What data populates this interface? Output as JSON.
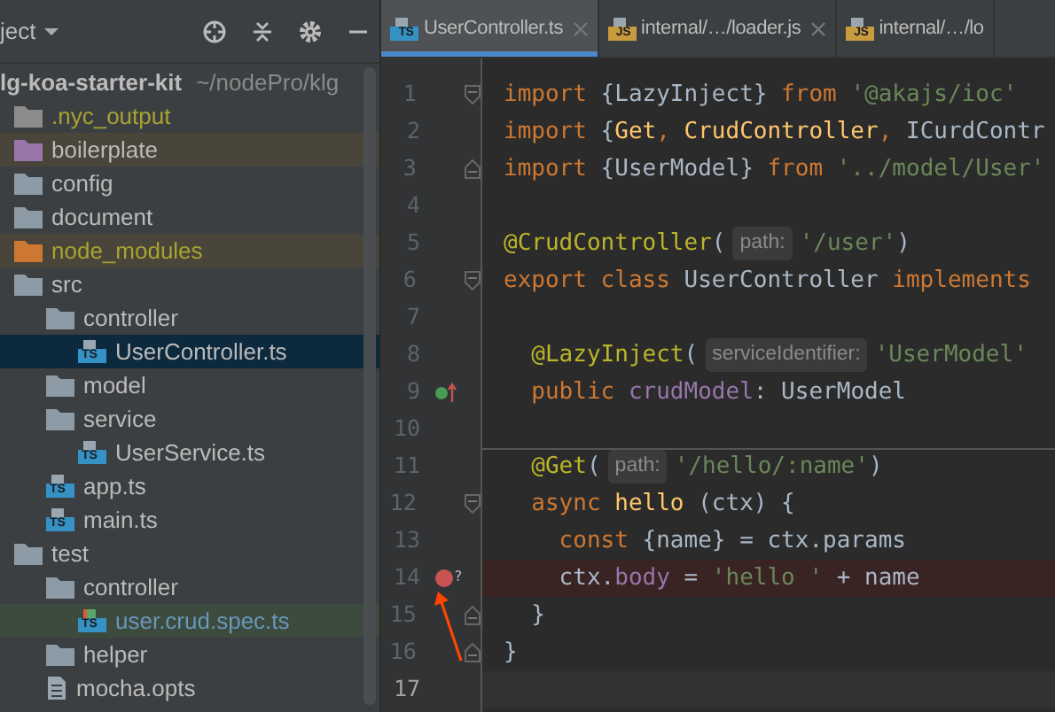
{
  "project_panel": {
    "title": "ject",
    "root": {
      "name": "lg-koa-starter-kit",
      "path": "~/nodePro/klg"
    },
    "tree": [
      {
        "name": ".nyc_output",
        "kind": "folder",
        "color": "#8c8c8c",
        "excluded": true,
        "highlighted": false,
        "selected": false,
        "focused": false,
        "modified": false
      },
      {
        "name": "boilerplate",
        "kind": "folder",
        "color": "#9876aa",
        "excluded": false,
        "highlighted": true,
        "selected": false,
        "focused": false,
        "modified": false
      },
      {
        "name": "config",
        "kind": "folder",
        "color": "#8c9ba5",
        "excluded": false,
        "highlighted": false,
        "selected": false,
        "focused": false,
        "modified": false
      },
      {
        "name": "document",
        "kind": "folder",
        "color": "#8c9ba5",
        "excluded": false,
        "highlighted": false,
        "selected": false,
        "focused": false,
        "modified": false
      },
      {
        "name": "node_modules",
        "kind": "folder",
        "color": "#cc7832",
        "excluded": true,
        "highlighted": true,
        "selected": false,
        "focused": false,
        "modified": false
      },
      {
        "name": "src",
        "kind": "folder",
        "color": "#8c9ba5",
        "excluded": false,
        "highlighted": false,
        "selected": false,
        "focused": false,
        "modified": false,
        "children": [
          {
            "name": "controller",
            "kind": "folder",
            "color": "#8c9ba5",
            "excluded": false,
            "highlighted": false,
            "selected": false,
            "focused": false,
            "modified": false,
            "children": [
              {
                "name": "UserController.ts",
                "kind": "ts",
                "icon_label": "TS",
                "excluded": false,
                "highlighted": false,
                "selected": true,
                "focused": false,
                "modified": false
              }
            ]
          },
          {
            "name": "model",
            "kind": "folder",
            "color": "#8c9ba5",
            "excluded": false,
            "highlighted": false,
            "selected": false,
            "focused": false,
            "modified": false
          },
          {
            "name": "service",
            "kind": "folder",
            "color": "#8c9ba5",
            "excluded": false,
            "highlighted": false,
            "selected": false,
            "focused": false,
            "modified": false,
            "children": [
              {
                "name": "UserService.ts",
                "kind": "ts",
                "icon_label": "TS",
                "excluded": false,
                "highlighted": false,
                "selected": false,
                "focused": false,
                "modified": false
              }
            ]
          },
          {
            "name": "app.ts",
            "kind": "ts",
            "icon_label": "TS",
            "excluded": false,
            "highlighted": false,
            "selected": false,
            "focused": false,
            "modified": false
          },
          {
            "name": "main.ts",
            "kind": "ts",
            "icon_label": "TS",
            "excluded": false,
            "highlighted": false,
            "selected": false,
            "focused": false,
            "modified": false
          }
        ]
      },
      {
        "name": "test",
        "kind": "folder",
        "color": "#8c9ba5",
        "excluded": false,
        "highlighted": false,
        "selected": false,
        "focused": false,
        "modified": false,
        "children": [
          {
            "name": "controller",
            "kind": "folder",
            "color": "#8c9ba5",
            "excluded": false,
            "highlighted": false,
            "selected": false,
            "focused": false,
            "modified": false,
            "children": [
              {
                "name": "user.crud.spec.ts",
                "kind": "test",
                "icon_label": "TS",
                "excluded": false,
                "highlighted": false,
                "selected": false,
                "focused": true,
                "modified": true
              }
            ]
          },
          {
            "name": "helper",
            "kind": "folder",
            "color": "#8c9ba5",
            "excluded": false,
            "highlighted": false,
            "selected": false,
            "focused": false,
            "modified": false
          },
          {
            "name": "mocha.opts",
            "kind": "file",
            "excluded": false,
            "highlighted": false,
            "selected": false,
            "focused": false,
            "modified": false
          }
        ]
      }
    ]
  },
  "tabs": [
    {
      "label": "UserController.ts",
      "kind": "ts",
      "icon_label": "TS",
      "selected": true,
      "closable": true
    },
    {
      "label": "internal/…/loader.js",
      "kind": "js",
      "icon_label": "JS",
      "selected": false,
      "closable": true
    },
    {
      "label": "internal/…/lo",
      "kind": "js",
      "icon_label": "JS",
      "selected": false,
      "closable": false
    }
  ],
  "editor": {
    "lines": [
      {
        "number": "1",
        "fold_start": true,
        "fold_end": false,
        "implemented": false,
        "breakpoint": false,
        "current": false,
        "method_separator": false,
        "tokens": [
          {
            "kind": "kw",
            "text": "import "
          },
          {
            "kind": "plain",
            "text": "{LazyInject} "
          },
          {
            "kind": "kw",
            "text": "from "
          },
          {
            "kind": "str",
            "text": "'@akajs/ioc'"
          }
        ]
      },
      {
        "number": "2",
        "fold_start": false,
        "fold_end": false,
        "implemented": false,
        "breakpoint": false,
        "current": false,
        "method_separator": false,
        "tokens": [
          {
            "kind": "kw",
            "text": "import "
          },
          {
            "kind": "plain",
            "text": "{"
          },
          {
            "kind": "fn",
            "text": "Get"
          },
          {
            "kind": "kw",
            "text": ", "
          },
          {
            "kind": "fn",
            "text": "CrudController"
          },
          {
            "kind": "kw",
            "text": ", "
          },
          {
            "kind": "plain",
            "text": "ICurdContr"
          }
        ]
      },
      {
        "number": "3",
        "fold_start": false,
        "fold_end": true,
        "implemented": false,
        "breakpoint": false,
        "current": false,
        "method_separator": false,
        "tokens": [
          {
            "kind": "kw",
            "text": "import "
          },
          {
            "kind": "plain",
            "text": "{UserModel} "
          },
          {
            "kind": "kw",
            "text": "from "
          },
          {
            "kind": "str",
            "text": "'../model/User'"
          }
        ]
      },
      {
        "number": "4",
        "fold_start": false,
        "fold_end": false,
        "implemented": false,
        "breakpoint": false,
        "current": false,
        "method_separator": false
      },
      {
        "number": "5",
        "fold_start": false,
        "fold_end": false,
        "implemented": false,
        "breakpoint": false,
        "current": false,
        "method_separator": false,
        "tokens": [
          {
            "kind": "ann",
            "text": "@CrudController"
          },
          {
            "kind": "plain",
            "text": "("
          },
          {
            "kind": "hint",
            "text": "path:"
          },
          {
            "kind": "str",
            "text": "'/user'"
          },
          {
            "kind": "plain",
            "text": ")"
          }
        ]
      },
      {
        "number": "6",
        "fold_start": true,
        "fold_end": false,
        "implemented": false,
        "breakpoint": false,
        "current": false,
        "method_separator": false,
        "tokens": [
          {
            "kind": "kw",
            "text": "export class "
          },
          {
            "kind": "plain",
            "text": "UserController "
          },
          {
            "kind": "kw",
            "text": "implements"
          }
        ]
      },
      {
        "number": "7",
        "fold_start": false,
        "fold_end": false,
        "implemented": false,
        "breakpoint": false,
        "current": false,
        "method_separator": false
      },
      {
        "number": "8",
        "fold_start": false,
        "fold_end": false,
        "implemented": false,
        "breakpoint": false,
        "current": false,
        "method_separator": false,
        "tokens": [
          {
            "kind": "ann",
            "text": "  @LazyInject"
          },
          {
            "kind": "plain",
            "text": "("
          },
          {
            "kind": "hint",
            "text": "serviceIdentifier:"
          },
          {
            "kind": "str",
            "text": "'UserModel'"
          }
        ]
      },
      {
        "number": "9",
        "fold_start": false,
        "fold_end": false,
        "implemented": true,
        "breakpoint": false,
        "current": false,
        "method_separator": false,
        "tokens": [
          {
            "kind": "kw",
            "text": "  public "
          },
          {
            "kind": "prop",
            "text": "crudModel"
          },
          {
            "kind": "plain",
            "text": ": UserModel"
          }
        ]
      },
      {
        "number": "10",
        "fold_start": false,
        "fold_end": false,
        "implemented": false,
        "breakpoint": false,
        "current": false,
        "method_separator": false
      },
      {
        "number": "11",
        "fold_start": false,
        "fold_end": false,
        "implemented": false,
        "breakpoint": false,
        "current": false,
        "method_separator": true,
        "tokens": [
          {
            "kind": "ann",
            "text": "  @Get"
          },
          {
            "kind": "plain",
            "text": "("
          },
          {
            "kind": "hint",
            "text": "path:"
          },
          {
            "kind": "str",
            "text": "'/hello/:name'"
          },
          {
            "kind": "plain",
            "text": ")"
          }
        ]
      },
      {
        "number": "12",
        "fold_start": true,
        "fold_end": false,
        "implemented": false,
        "breakpoint": false,
        "current": false,
        "method_separator": false,
        "tokens": [
          {
            "kind": "kw",
            "text": "  async "
          },
          {
            "kind": "fn",
            "text": "hello "
          },
          {
            "kind": "plain",
            "text": "(ctx) {"
          }
        ]
      },
      {
        "number": "13",
        "fold_start": false,
        "fold_end": false,
        "implemented": false,
        "breakpoint": false,
        "current": false,
        "method_separator": false,
        "tokens": [
          {
            "kind": "kw",
            "text": "    const "
          },
          {
            "kind": "plain",
            "text": "{name} = ctx.params"
          }
        ]
      },
      {
        "number": "14",
        "fold_start": false,
        "fold_end": false,
        "implemented": false,
        "breakpoint": true,
        "breakpoint_hint": "?",
        "current": false,
        "method_separator": false,
        "tokens": [
          {
            "kind": "plain",
            "text": "    ctx."
          },
          {
            "kind": "prop",
            "text": "body"
          },
          {
            "kind": "plain",
            "text": " = "
          },
          {
            "kind": "str",
            "text": "'hello '"
          },
          {
            "kind": "plain",
            "text": " + name"
          }
        ]
      },
      {
        "number": "15",
        "fold_start": false,
        "fold_end": true,
        "implemented": false,
        "breakpoint": false,
        "current": false,
        "method_separator": false,
        "tokens": [
          {
            "kind": "plain",
            "text": "  }"
          }
        ]
      },
      {
        "number": "16",
        "fold_start": false,
        "fold_end": true,
        "implemented": false,
        "breakpoint": false,
        "current": false,
        "method_separator": false,
        "tokens": [
          {
            "kind": "plain",
            "text": "}"
          }
        ]
      },
      {
        "number": "17",
        "fold_start": false,
        "fold_end": false,
        "implemented": false,
        "breakpoint": false,
        "current": true,
        "method_separator": false
      }
    ]
  }
}
